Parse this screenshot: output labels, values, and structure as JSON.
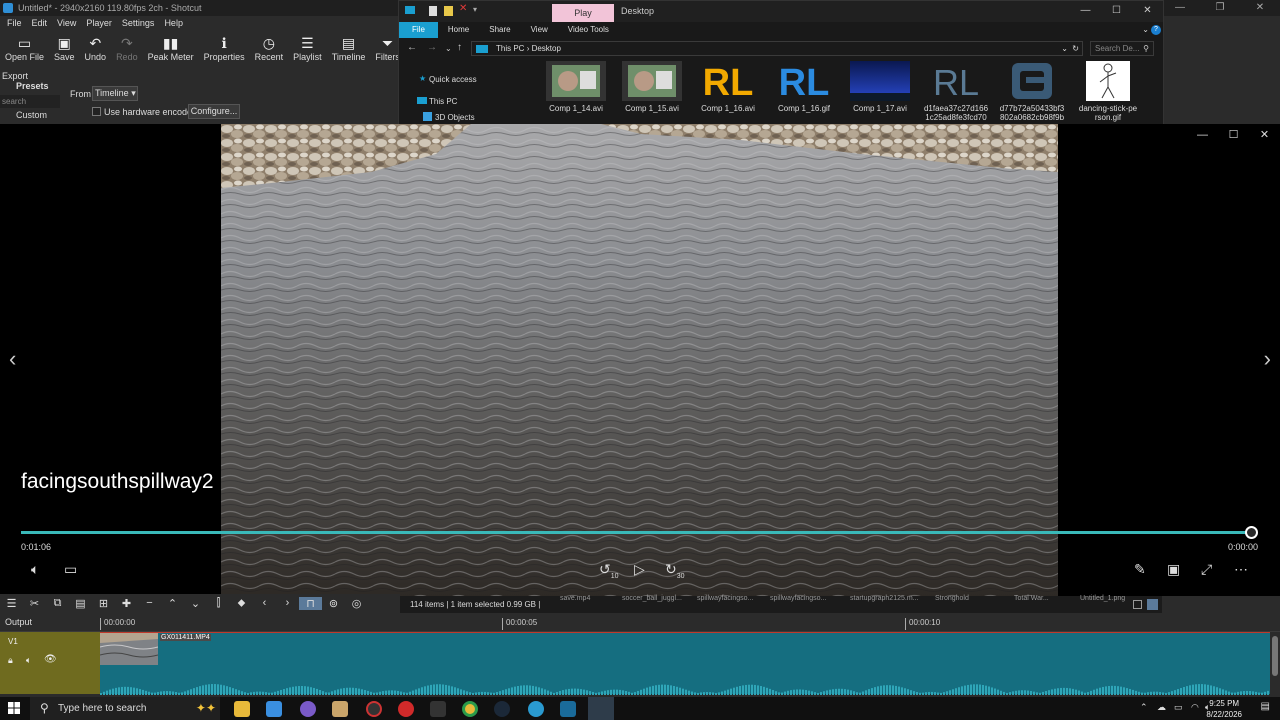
{
  "shotcut": {
    "title": "Untitled* - 2940x2160 119.80fps 2ch - Shotcut",
    "menu": [
      "File",
      "Edit",
      "View",
      "Player",
      "Settings",
      "Help"
    ],
    "toolbar": [
      {
        "label": "Open File",
        "icon": "open-file-icon",
        "glyph": "▭"
      },
      {
        "label": "Save",
        "icon": "save-icon",
        "glyph": "▣"
      },
      {
        "label": "Undo",
        "icon": "undo-icon",
        "glyph": "↶"
      },
      {
        "label": "Redo",
        "icon": "redo-icon",
        "glyph": "↷"
      },
      {
        "label": "Peak Meter",
        "icon": "peak-meter-icon",
        "glyph": "▮▮"
      },
      {
        "label": "Properties",
        "icon": "properties-icon",
        "glyph": "ℹ"
      },
      {
        "label": "Recent",
        "icon": "recent-icon",
        "glyph": "◷"
      },
      {
        "label": "Playlist",
        "icon": "playlist-icon",
        "glyph": "☰"
      },
      {
        "label": "Timeline",
        "icon": "timeline-icon",
        "glyph": "▤"
      },
      {
        "label": "Filters",
        "icon": "filters-icon",
        "glyph": "⏷"
      },
      {
        "label": "Keyfra",
        "icon": "keyframes-icon",
        "glyph": "◷"
      }
    ],
    "export": {
      "title": "Export",
      "presets_label": "Presets",
      "search_placeholder": "search",
      "custom_item": "Custom",
      "from_label": "From",
      "from_value": "Timeline",
      "hw_encoder_label": "Use hardware encoder",
      "configure_button": "Configure..."
    }
  },
  "explorer": {
    "play_tab": "Play",
    "title": "Desktop",
    "ribbon_tabs": [
      "File",
      "Home",
      "Share",
      "View",
      "Video Tools"
    ],
    "breadcrumb": [
      "This PC",
      "Desktop"
    ],
    "search_placeholder": "Search De...",
    "nav": [
      "Quick access",
      "This PC",
      "3D Objects"
    ],
    "files": [
      {
        "name": "Comp 1_14.avi",
        "kind": "face"
      },
      {
        "name": "Comp 1_15.avi",
        "kind": "face"
      },
      {
        "name": "Comp 1_16.avi",
        "kind": "rl-yellow"
      },
      {
        "name": "Comp 1_16.gif",
        "kind": "rl-blue"
      },
      {
        "name": "Comp 1_17.avi",
        "kind": "night"
      },
      {
        "name": "d1faea37c27d166 1c25ad8fe3fcd70",
        "kind": "rl-grey"
      },
      {
        "name": "d77b72a50433bf3 802a0682cb98f9b",
        "kind": "logo"
      },
      {
        "name": "dancing-stick-pe rson.gif",
        "kind": "stick"
      }
    ]
  },
  "viewer": {
    "caption": "facingsouthspillway2",
    "time_elapsed": "0:01:06",
    "time_remaining": "0:00:00",
    "progress": 1.0,
    "rewind_label": "10",
    "forward_label": "30"
  },
  "timeline": {
    "toolbar_icons": [
      "menu-icon",
      "cut-icon",
      "copy-icon",
      "paste-icon",
      "append-icon",
      "add-icon",
      "remove-icon",
      "lift-icon",
      "overwrite-icon",
      "split-icon",
      "marker-icon",
      "prev-icon",
      "next-icon",
      "snap-icon",
      "scrub-icon",
      "ripple-icon"
    ],
    "status_items": "114 items",
    "status_selected": "1 item selected  0.99 GB",
    "status_names": [
      "save.mp4",
      "soccer_ball_juggl...",
      "spillwayfacingso...",
      "spillwayfacingso...",
      "startupgraph2125.m...",
      "Stronghold",
      "Total War...",
      "Untitled_1.png"
    ],
    "output_label": "Output",
    "track_label": "V1",
    "ticks": [
      "00:00:00",
      "00:00:05",
      "00:00:10"
    ],
    "clip_name": "GX011411.MP4"
  },
  "taskbar": {
    "search_placeholder": "Type here to search",
    "time": "9:25 PM",
    "date": "8/22/2026"
  }
}
